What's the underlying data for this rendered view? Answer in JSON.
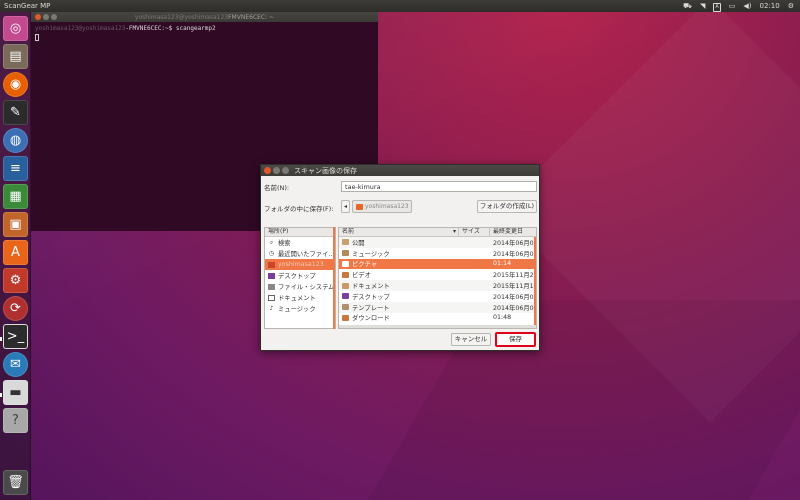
{
  "top_panel": {
    "app_title": "ScanGear MP",
    "indicators": {
      "keyboard": "A",
      "time": "02:10"
    }
  },
  "terminal": {
    "title_suffix": "FMVNE6CEC: ~",
    "user_blurred": "yoshimasa123@yoshimasa123",
    "prompt_host": "-FMVNE6CEC:~$ ",
    "command": "scangearmp2"
  },
  "dialog": {
    "title": "スキャン画像の保存",
    "name_label": "名前(N):",
    "name_value": "tae-kimura",
    "folder_label": "フォルダの中に保存(F):",
    "path_button": "yoshimasa123",
    "create_folder_label": "フォルダの作成(L)",
    "places_header": "場所(P)",
    "places": [
      {
        "label": "検索",
        "icon": "search-icon"
      },
      {
        "label": "最近開いたファイ…",
        "icon": "recent-icon"
      },
      {
        "label": "yoshimasa123",
        "icon": "home-icon",
        "selected": true
      },
      {
        "label": "デスクトップ",
        "icon": "desktop-icon"
      },
      {
        "label": "ファイル・システム",
        "icon": "drive-icon"
      },
      {
        "label": "ドキュメント",
        "icon": "document-icon"
      },
      {
        "label": "ミュージック",
        "icon": "music-icon"
      }
    ],
    "columns": {
      "name": "名前",
      "size": "サイズ",
      "date": "最終変更日"
    },
    "files": [
      {
        "name": "公開",
        "size": "",
        "date": "2014年06月01"
      },
      {
        "name": "ミュージック",
        "size": "",
        "date": "2014年06月01"
      },
      {
        "name": "ピクチャ",
        "size": "",
        "date": "01:14",
        "selected": true
      },
      {
        "name": "ビデオ",
        "size": "",
        "date": "2015年11月20"
      },
      {
        "name": "ドキュメント",
        "size": "",
        "date": "2015年11月18"
      },
      {
        "name": "デスクトップ",
        "size": "",
        "date": "2014年06月01"
      },
      {
        "name": "テンプレート",
        "size": "",
        "date": "2014年06月01"
      },
      {
        "name": "ダウンロード",
        "size": "",
        "date": "01:48"
      }
    ],
    "cancel_label": "キャンセル",
    "save_label": "保存"
  },
  "colors": {
    "accent": "#f07746",
    "highlight_box": "#e0001a",
    "terminal_bg": "#300a24"
  }
}
